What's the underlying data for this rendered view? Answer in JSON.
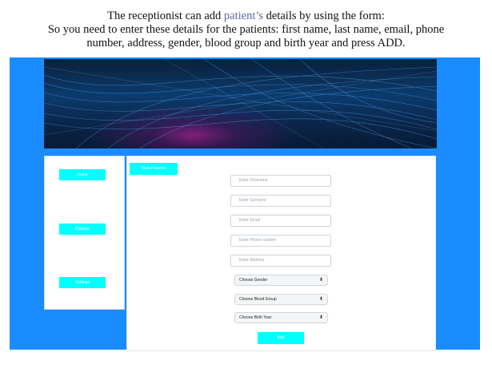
{
  "caption": {
    "line1_before": "The receptionist can add ",
    "line1_highlight": "patient’s",
    "line1_after": " details by using the form:",
    "line2": "So you need to enter these details for the patients: first name, last name, email, phone",
    "line3": "number, address, gender, blood group and birth year and press ADD."
  },
  "sidebar": {
    "items": [
      {
        "label": "Home"
      },
      {
        "label": "Patients"
      },
      {
        "label": "Settings"
      }
    ]
  },
  "main": {
    "view_button": "View Patients",
    "fields": {
      "firstname_placeholder": "Enter Firstname",
      "surname_placeholder": "Enter Surname",
      "email_placeholder": "Enter Email",
      "phone_placeholder": "Enter Phone number",
      "address_placeholder": "Enter Address"
    },
    "selects": {
      "gender": "Choose Gender",
      "blood_group": "Choose Blood Group",
      "birth_year": "Choose Birth Year"
    },
    "add_button": "Add"
  },
  "colors": {
    "frame": "#1a8cff",
    "button": "#00ffff"
  }
}
